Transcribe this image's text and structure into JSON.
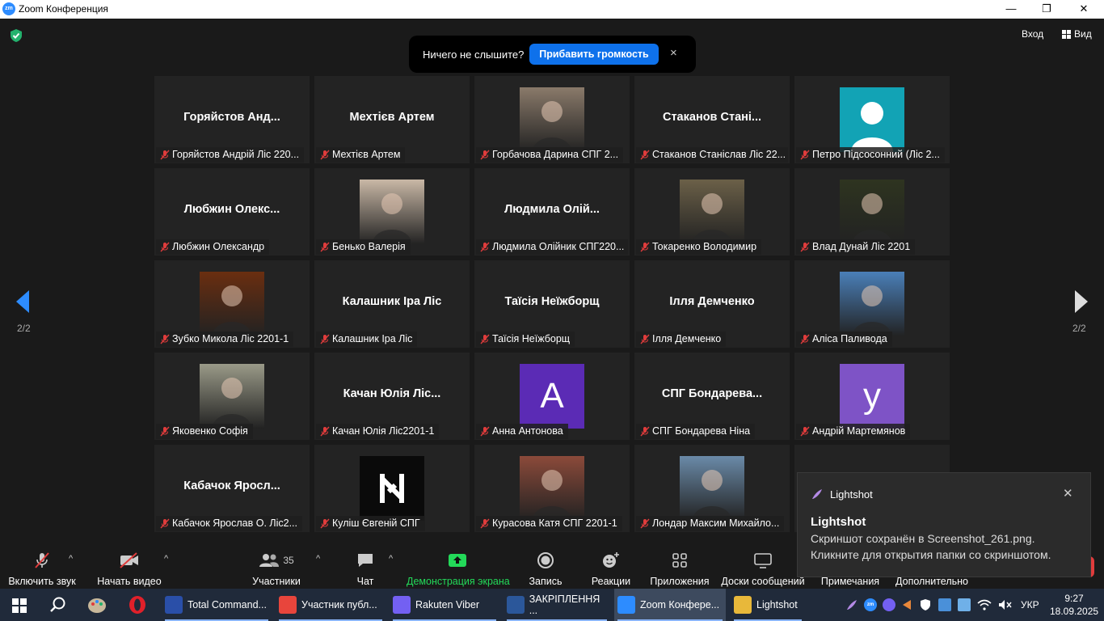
{
  "window": {
    "title": "Zoom Конференция",
    "logo": "zm",
    "minimize": "—",
    "restore": "❐",
    "close": "✕"
  },
  "top_right": {
    "exit": "Вход",
    "view": "Вид"
  },
  "audio_notice": {
    "text": "Ничего не слышите?",
    "button": "Прибавить громкость",
    "close": "×"
  },
  "pagination": {
    "left": "2/2",
    "right": "2/2"
  },
  "tiles": [
    {
      "big": "Горяйстов  Анд...",
      "label": "Горяйстов Андрій Ліс 220..."
    },
    {
      "big": "Мехтієв Артем",
      "label": "Мехтієв Артем"
    },
    {
      "big": "",
      "label": "Горбачова Дарина СПГ 2...",
      "photo": "#8a7a6a"
    },
    {
      "big": "Стаканов  Стані...",
      "label": "Стаканов Станіслав Ліс 22..."
    },
    {
      "big": "",
      "label": "Петро Підсосонний (Ліс 2...",
      "avatar": "#12a3b5"
    },
    {
      "big": "Любжин  Олекс...",
      "label": "Любжин Олександр"
    },
    {
      "big": "",
      "label": "Бенько Валерія",
      "photo": "#c9b8a6"
    },
    {
      "big": "Людмила  Олій...",
      "label": "Людмила Олійник СПГ220..."
    },
    {
      "big": "",
      "label": "Токаренко  Володимир",
      "photo": "#6b6048"
    },
    {
      "big": "",
      "label": "Влад Дунай Ліс 2201",
      "photo": "#2e3420"
    },
    {
      "big": "",
      "label": "Зубко Микола  Ліс 2201-1",
      "photo": "#6a2e10"
    },
    {
      "big": "Калашник Іра Ліс",
      "label": "Калашник Іра Ліс"
    },
    {
      "big": "Таїсія Неїжборщ",
      "label": "Таїсія Неїжборщ"
    },
    {
      "big": "Ілля Демченко",
      "label": "Ілля Демченко"
    },
    {
      "big": "",
      "label": "Аліса Паливода",
      "photo": "#4a7fb8"
    },
    {
      "big": "",
      "label": "Яковенко Софія",
      "photo": "#9a9a88"
    },
    {
      "big": "Качан  Юлія Ліс...",
      "label": "Качан Юлія Ліс2201-1"
    },
    {
      "big": "",
      "label": "Анна Антонова",
      "letter": "A",
      "lcolor": "#5b2bb5"
    },
    {
      "big": "СПГ  Бондарева...",
      "label": "СПГ Бондарева Ніна"
    },
    {
      "big": "",
      "label": "Андрій Мартемянов",
      "letter": "y",
      "lcolor": "#7e53c6"
    },
    {
      "big": "Кабачок  Яросл...",
      "label": "Кабачок Ярослав О. Ліс2..."
    },
    {
      "big": "",
      "label": "Куліш Євгеній СПГ",
      "logo": true
    },
    {
      "big": "",
      "label": "Курасова Катя СПГ 2201-1",
      "photo": "#8b4a3a"
    },
    {
      "big": "",
      "label": "Лондар Максим Михайло...",
      "photo": "#6a8aa8"
    }
  ],
  "toolbar": {
    "audio": "Включить звук",
    "video": "Начать видео",
    "participants": "Участники",
    "participants_count": "35",
    "chat": "Чат",
    "share": "Демонстрация экрана",
    "record": "Запись",
    "reactions": "Реакции",
    "apps": "Приложения",
    "whiteboards": "Доски сообщений",
    "notes": "Примечания",
    "more": "Дополнительно"
  },
  "toast": {
    "app": "Lightshot",
    "title": "Lightshot",
    "line1": "Скриншот сохранён в Screenshot_261.png.",
    "line2": "Кликните для открытия папки со скриншотом.",
    "close": "✕"
  },
  "taskbar": {
    "items": [
      {
        "label": "Total Command...",
        "color": "#2a4fa8"
      },
      {
        "label": "Участник публ...",
        "color": "#e8453c"
      },
      {
        "label": "Rakuten Viber",
        "color": "#7360f2"
      },
      {
        "label": "ЗАКРІПЛЕННЯ ...",
        "color": "#2b579a"
      },
      {
        "label": "Zoom Конфере...",
        "color": "#2d8cff"
      },
      {
        "label": "Lightshot",
        "color": "#e8b83a"
      }
    ],
    "lang": "УКР",
    "time": "9:27",
    "date": "18.09.2025"
  },
  "colors": {
    "accent": "#0e71eb",
    "share_green": "#23d959",
    "muted_red": "#e03c3c"
  }
}
